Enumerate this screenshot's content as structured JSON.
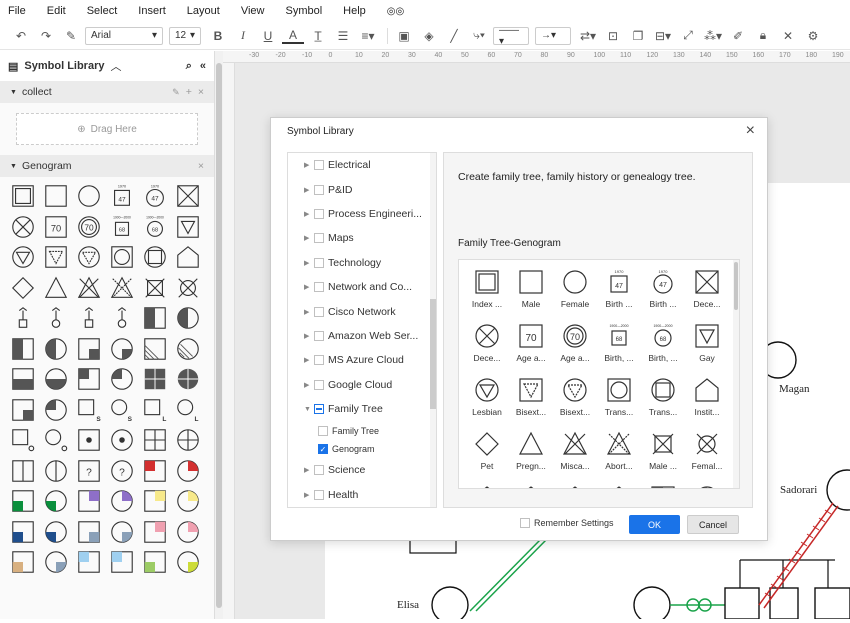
{
  "menu": [
    "File",
    "Edit",
    "Select",
    "Insert",
    "Layout",
    "View",
    "Symbol",
    "Help"
  ],
  "toolbar": {
    "font": "Arial",
    "size": "12"
  },
  "sidebar": {
    "title": "Symbol Library",
    "collect_label": "collect",
    "drag_here": "Drag Here",
    "genogram_label": "Genogram"
  },
  "ruler": [
    "-30",
    "-20",
    "-10",
    "0",
    "10",
    "20",
    "30",
    "40",
    "50",
    "60",
    "70",
    "80",
    "90",
    "100",
    "110",
    "120",
    "130",
    "140",
    "150",
    "160",
    "170",
    "180",
    "190"
  ],
  "canvas": {
    "magan": "Magan",
    "sadorari": "Sadorari",
    "elisa": "Elisa",
    "partial_letter": "n"
  },
  "dialog": {
    "title": "Symbol Library",
    "description": "Create family tree, family history or genealogy tree.",
    "section_title": "Family Tree-Genogram",
    "remember": "Remember Settings",
    "ok": "OK",
    "cancel": "Cancel",
    "tree": [
      {
        "label": "Electrical",
        "checked": "none"
      },
      {
        "label": "P&ID",
        "checked": "none"
      },
      {
        "label": "Process Engineeri...",
        "checked": "none"
      },
      {
        "label": "Maps",
        "checked": "none"
      },
      {
        "label": "Technology",
        "checked": "none"
      },
      {
        "label": "Network and Co...",
        "checked": "none"
      },
      {
        "label": "Cisco Network",
        "checked": "none"
      },
      {
        "label": "Amazon Web Ser...",
        "checked": "none"
      },
      {
        "label": "MS Azure Cloud",
        "checked": "none"
      },
      {
        "label": "Google Cloud",
        "checked": "none"
      },
      {
        "label": "Family Tree",
        "checked": "partial"
      }
    ],
    "subitems": [
      {
        "label": "Family Tree",
        "checked": false
      },
      {
        "label": "Genogram",
        "checked": true
      }
    ],
    "tree_after": [
      {
        "label": "Science"
      },
      {
        "label": "Health"
      }
    ],
    "symbols": [
      "Index ...",
      "Male",
      "Female",
      "Birth ...",
      "Birth ...",
      "Dece...",
      "Dece...",
      "Age a...",
      "Age a...",
      "Birth, ...",
      "Birth, ...",
      "Gay",
      "Lesbian",
      "Bisext...",
      "Bisext...",
      "Trans...",
      "Trans...",
      "Instit...",
      "Pet",
      "Pregn...",
      "Misca...",
      "Abort...",
      "Male ...",
      "Femal..."
    ],
    "age_value": "70",
    "birth_value": "47",
    "birth_year": "1970",
    "birth_range_a": "1900",
    "birth_range_b": "2000",
    "birth_range_value": "68"
  }
}
